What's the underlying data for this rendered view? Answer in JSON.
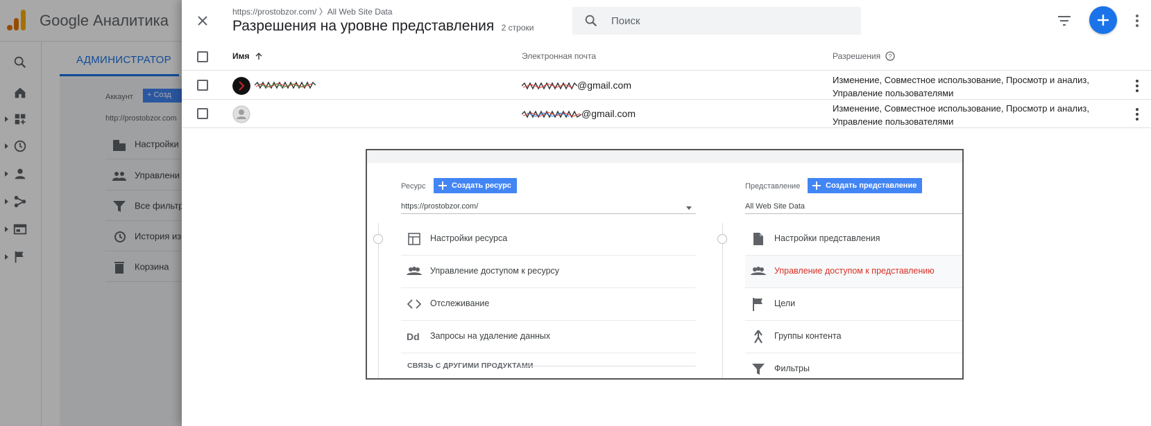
{
  "background": {
    "app_title": "Google Аналитика",
    "admin_tab": "АДМИНИСТРАТОР",
    "account_label": "Аккаунт",
    "create_button": "Созд",
    "url": "http://prostobzor.com",
    "menu": [
      "Настройки",
      "Управлени",
      "Все фильтр",
      "История из",
      "Корзина"
    ]
  },
  "panel": {
    "breadcrumb": "https://prostobzor.com/ 〉All Web Site Data",
    "title": "Разрешения на уровне представления",
    "row_count": "2 строки",
    "search_placeholder": "Поиск"
  },
  "table": {
    "headers": {
      "name": "Имя",
      "email": "Электронная почта",
      "permissions": "Разрешения"
    },
    "rows": [
      {
        "email_suffix": "@gmail.com",
        "permissions": "Изменение, Совместное использование, Просмотр и анализ, Управление пользователями"
      },
      {
        "email_suffix": "@gmail.com",
        "permissions": "Изменение, Совместное использование, Просмотр и анализ, Управление пользователями"
      }
    ]
  },
  "embed": {
    "resource_label": "Ресурс",
    "create_resource": "Создать ресурс",
    "resource_url": "https://prostobzor.com/",
    "view_label": "Представление",
    "create_view": "Создать представление",
    "view_value": "All Web Site Data",
    "left_items": [
      "Настройки ресурса",
      "Управление доступом к ресурсу",
      "Отслеживание",
      "Запросы на удаление данных"
    ],
    "left_icons": [
      "layout-icon",
      "people-icon",
      "code-icon",
      "dd-icon"
    ],
    "dd_text": "Dd",
    "section_title": "СВЯЗЬ С ДРУГИМИ ПРОДУКТАМИ",
    "right_items": [
      "Настройки представления",
      "Управление доступом к представлению",
      "Цели",
      "Группы контента",
      "Фильтры"
    ],
    "right_icons": [
      "document-icon",
      "people-icon",
      "flag-icon",
      "walker-icon",
      "filter-icon"
    ],
    "active_right_index": 1,
    "accent_color": "#d93025"
  },
  "colors": {
    "primary": "#1a73e8",
    "button_blue": "#4285f4"
  }
}
